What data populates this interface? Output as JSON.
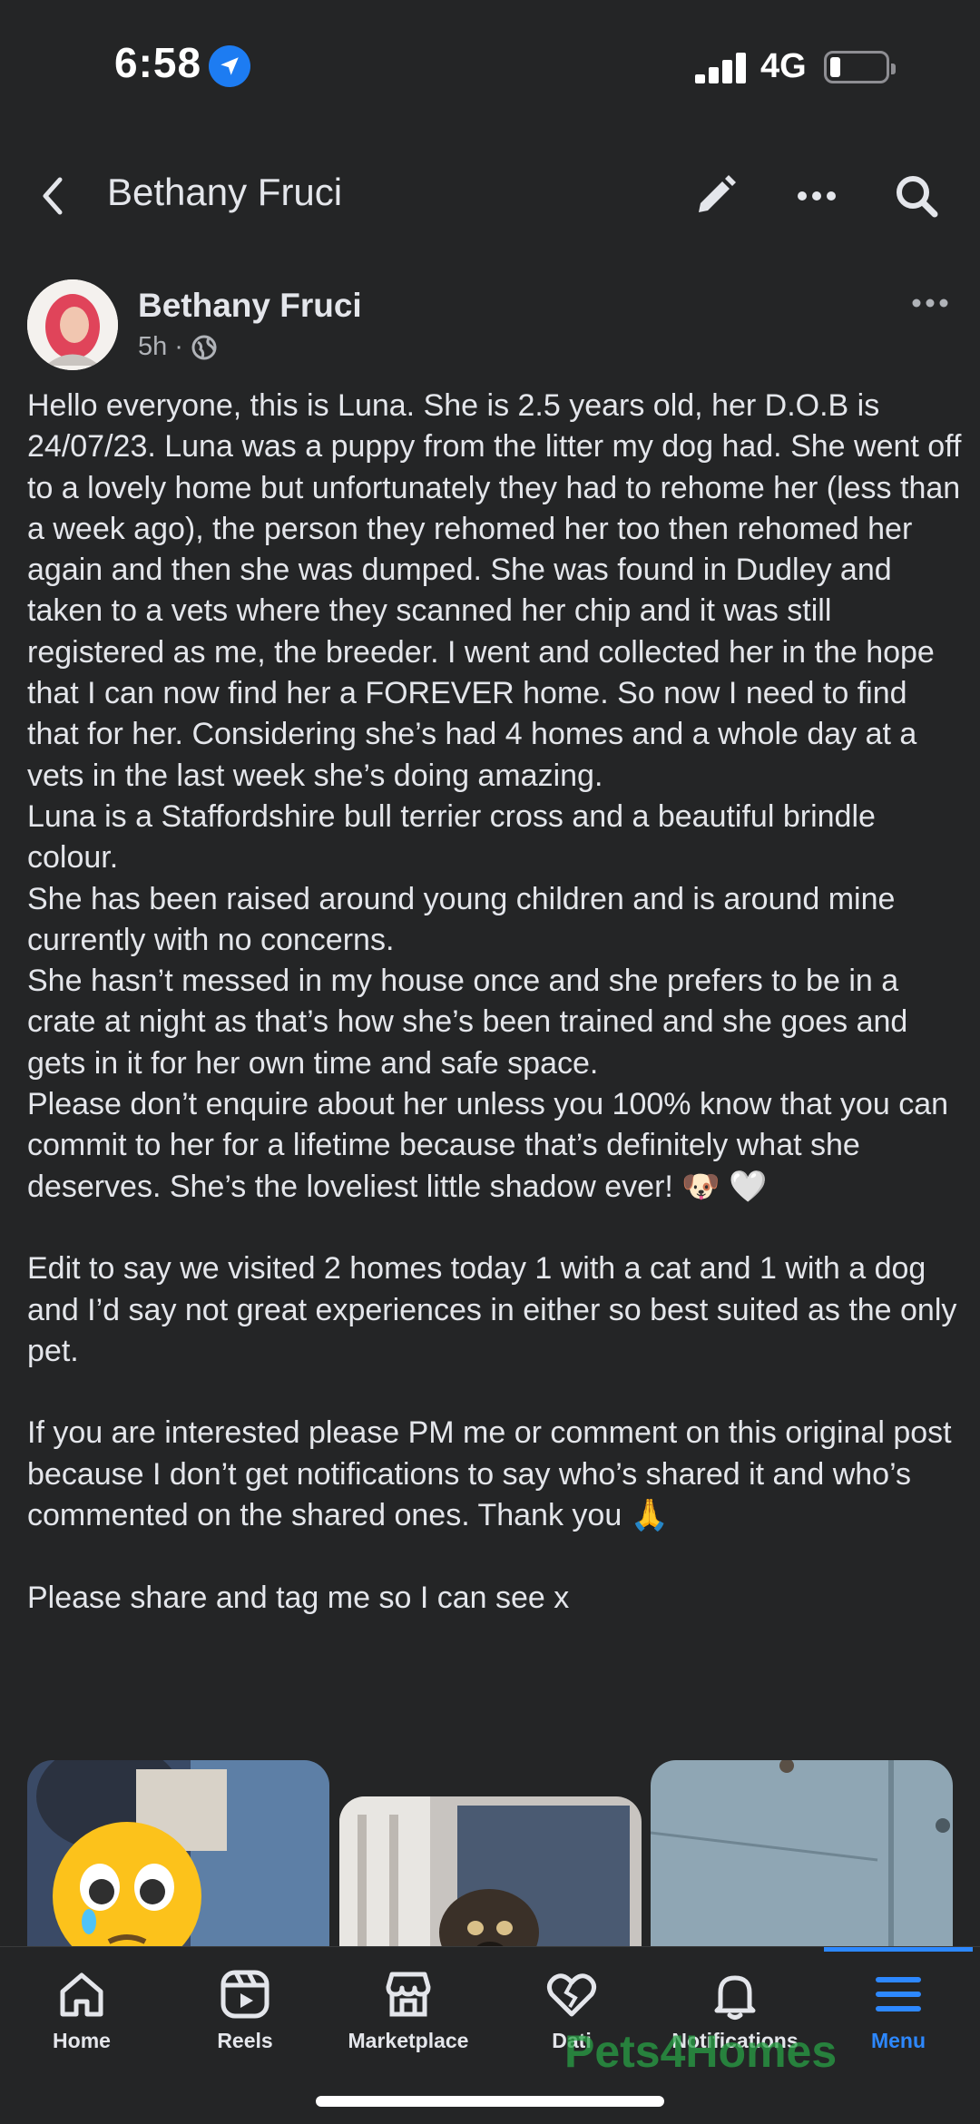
{
  "status": {
    "time": "6:58",
    "network": "4G"
  },
  "header": {
    "title": "Bethany Fruci"
  },
  "post": {
    "author": "Bethany Fruci",
    "time": "5h",
    "separator": "·",
    "paragraphs": [
      "Hello everyone, this is Luna. She is 2.5 years old, her D.O.B is 24/07/23. Luna was a puppy from the litter my dog had. She went off to a lovely home but unfortunately they had to rehome her (less than a week ago), the person they rehomed her too then rehomed her again and then she was dumped. She was found in Dudley and taken to a vets where they scanned her chip and it was still registered as me, the breeder. I went and collected her in the hope that I can now find her a  FOREVER home. So now I need to find that for her. Considering she’s had 4 homes and a whole day at a vets in the last week she’s doing amazing.\n Luna is a Staffordshire bull terrier cross and a beautiful brindle colour.\nShe has been raised around young children and is around mine currently with no concerns.\nShe hasn’t messed in my house once and she prefers to be in a crate at night as that’s how she’s been trained and she goes and gets in it for her own time and safe space.\nPlease don’t enquire about her unless you 100% know that you can commit to her for a lifetime because that’s definitely what she deserves. She’s the loveliest little shadow ever!",
      "Edit to say we visited 2 homes today 1 with a cat and 1 with a dog and I’d say not great experiences in either so best suited as the only pet.",
      "If you are interested please PM me or comment on this original post because I don’t get notifications to say who’s shared it and who’s commented on the shared ones. Thank you",
      "Please share and tag me so I can see x"
    ],
    "emoji_dog": "🐶",
    "emoji_heart": "🤍",
    "emoji_pray": "🙏"
  },
  "photos": [
    {
      "icon": "pleading-face-sticker"
    },
    {
      "icon": "dog-photo"
    },
    {
      "icon": "wall-photo"
    }
  ],
  "nav": {
    "items": [
      {
        "label": "Home",
        "icon": "home-icon"
      },
      {
        "label": "Reels",
        "icon": "reels-icon"
      },
      {
        "label": "Marketplace",
        "icon": "marketplace-icon"
      },
      {
        "label": "Dati",
        "icon": "dating-icon"
      },
      {
        "label": "Notifications",
        "icon": "bell-icon"
      },
      {
        "label": "Menu",
        "icon": "menu-icon"
      }
    ],
    "active": "Menu"
  },
  "watermark": "Pets4Homes",
  "colors": {
    "background": "#242526",
    "accent": "#2d88ff",
    "text": "#e4e6eb",
    "muted": "#b0b3b8"
  }
}
